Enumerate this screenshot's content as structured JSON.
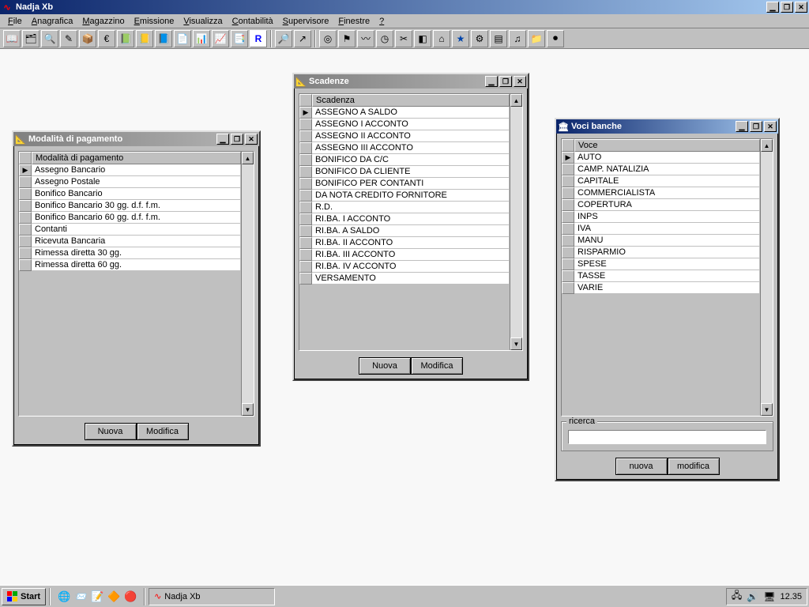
{
  "app": {
    "title": "Nadja Xb",
    "menus": [
      "File",
      "Anagrafica",
      "Magazzino",
      "Emissione",
      "Visualizza",
      "Contabilità",
      "Supervisore",
      "Finestre",
      "?"
    ]
  },
  "toolbar_icons": [
    "book-icon",
    "card-icon",
    "zoom-icon",
    "pencil-red-icon",
    "package-icon",
    "euro-icon",
    "green-book-icon",
    "note-yellow-icon",
    "note-blue-icon",
    "doc-blue-icon",
    "bars-icon",
    "chart-icon",
    "copy-icon",
    "r-icon",
    "search-green-icon",
    "export-icon",
    "target-icon",
    "flag-icon",
    "wave-icon",
    "pie-wave-icon",
    "scissors-icon",
    "cube-icon",
    "house-green-icon",
    "star-icon",
    "settings-icon",
    "doc-grey-icon",
    "music-icon",
    "folder-icon",
    "tape-icon"
  ],
  "windows": {
    "pagamento": {
      "title": "Modalità di pagamento",
      "header": "Modalità di pagamento",
      "rows": [
        "Assegno Bancario",
        "Assegno Postale",
        "Bonifico Bancario",
        "Bonifico Bancario 30 gg. d.f. f.m.",
        "Bonifico Bancario 60 gg. d.f. f.m.",
        "Contanti",
        "Ricevuta Bancaria",
        "Rimessa diretta 30 gg.",
        "Rimessa diretta 60 gg."
      ],
      "btn_new": "Nuova",
      "btn_edit": "Modifica"
    },
    "scadenze": {
      "title": "Scadenze",
      "header": "Scadenza",
      "rows": [
        "ASSEGNO A SALDO",
        "ASSEGNO I ACCONTO",
        "ASSEGNO II ACCONTO",
        "ASSEGNO III ACCONTO",
        "BONIFICO DA C/C",
        "BONIFICO DA CLIENTE",
        "BONIFICO PER CONTANTI",
        "DA NOTA CREDITO FORNITORE",
        "R.D.",
        "RI.BA.  I ACCONTO",
        "RI.BA. A SALDO",
        "RI.BA. II ACCONTO",
        "RI.BA. III ACCONTO",
        "RI.BA. IV ACCONTO",
        "VERSAMENTO"
      ],
      "btn_new": "Nuova",
      "btn_edit": "Modifica"
    },
    "voci": {
      "title": "Voci banche",
      "header": "Voce",
      "rows": [
        "AUTO",
        "CAMP. NATALIZIA",
        "CAPITALE",
        "COMMERCIALISTA",
        "COPERTURA",
        "INPS",
        "IVA",
        "MANU",
        "RISPARMIO",
        "SPESE",
        "TASSE",
        "VARIE"
      ],
      "search_label": "ricerca",
      "btn_new": "nuova",
      "btn_edit": "modifica"
    }
  },
  "taskbar": {
    "start": "Start",
    "app_task": "Nadja Xb",
    "clock": "12.35"
  }
}
